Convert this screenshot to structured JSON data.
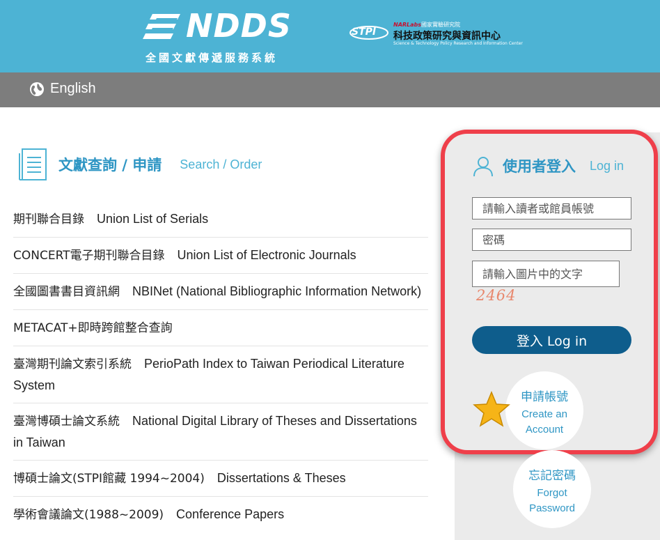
{
  "header": {
    "logo_text": "NDDS",
    "logo_subtitle": "全國文獻傳遞服務系統",
    "partner": {
      "badge": "STPI",
      "top_line_brand": "NARLabs",
      "top_line_rest": "國家實驗研究院",
      "main": "科技政策研究與資訊中心",
      "english": "Science & Technology Policy Research and Information Center"
    },
    "background_color": "#4db3d4"
  },
  "language": {
    "label": "English",
    "icon": "globe-icon"
  },
  "search_section": {
    "title": "文獻查詢 / 申請",
    "subtitle": "Search / Order",
    "icon": "document-icon",
    "items": [
      {
        "zh": "期刊聯合目錄",
        "en": "Union List of Serials"
      },
      {
        "zh": "CONCERT電子期刊聯合目錄",
        "en": "Union List of Electronic Journals"
      },
      {
        "zh": "全國圖書書目資訊網",
        "en": "NBINet (National Bibliographic Information Network)"
      },
      {
        "zh": "METACAT+即時跨館整合查詢",
        "en": ""
      },
      {
        "zh": "臺灣期刊論文索引系統",
        "en": "PerioPath Index to Taiwan Periodical Literature System"
      },
      {
        "zh": "臺灣博碩士論文系統",
        "en": "National Digital Library of Theses and Dissertations in Taiwan"
      },
      {
        "zh": "博碩士論文(STPI館藏 1994~2004)",
        "en": "Dissertations & Theses"
      },
      {
        "zh": "學術會議論文(1988~2009)",
        "en": "Conference Papers"
      }
    ]
  },
  "login": {
    "title": "使用者登入",
    "subtitle": "Log in",
    "icon": "user-icon",
    "account_placeholder": "請輸入讀者或館員帳號",
    "password_placeholder": "密碼",
    "captcha_placeholder": "請輸入圖片中的文字",
    "captcha_value": "2464",
    "button_label": "登入 Log in",
    "create_account": {
      "zh": "申請帳號",
      "en_line1": "Create an",
      "en_line2": "Account",
      "icon": "star-icon"
    },
    "forgot_password": {
      "zh": "忘記密碼",
      "en_line1": "Forgot",
      "en_line2": "Password"
    },
    "highlight_color": "#ef3f4a",
    "button_color": "#0e5d8c"
  }
}
